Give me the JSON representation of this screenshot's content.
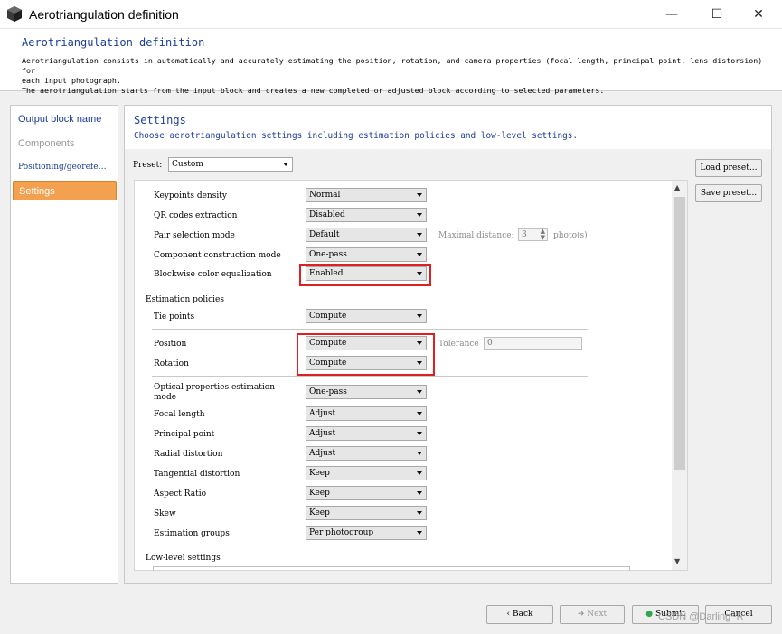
{
  "window": {
    "title": "Aerotriangulation definition",
    "minimize": "—",
    "maximize": "☐",
    "close": "✕"
  },
  "header": {
    "title": "Aerotriangulation definition",
    "desc_line1": "Aerotriangulation consists in automatically and accurately estimating the position, rotation, and camera properties (focal length, principal point, lens distorsion) for",
    "desc_line2": "each input photograph.",
    "desc_line3": "The aerotriangulation starts from the input block and creates a new completed or adjusted block according to selected parameters."
  },
  "nav": {
    "items": [
      {
        "label": "Output block name"
      },
      {
        "label": "Components"
      },
      {
        "label": "Positioning/georefe…"
      },
      {
        "label": "Settings"
      }
    ]
  },
  "main": {
    "title": "Settings",
    "desc": "Choose aerotriangulation settings including estimation policies and low-level settings.",
    "preset_label": "Preset:",
    "preset_value": "Custom",
    "load_preset": "Load preset...",
    "save_preset": "Save preset..."
  },
  "settings": {
    "keypoints_density": {
      "label": "Keypoints density",
      "value": "Normal"
    },
    "qr_codes": {
      "label": "QR codes extraction",
      "value": "Disabled"
    },
    "pair_selection": {
      "label": "Pair selection mode",
      "value": "Default"
    },
    "max_distance_label": "Maximal distance:",
    "max_distance_value": "3",
    "max_distance_unit": "photo(s)",
    "component_mode": {
      "label": "Component construction mode",
      "value": "One-pass"
    },
    "blockwise": {
      "label": "Blockwise color equalization",
      "value": "Enabled"
    },
    "estimation_policies": "Estimation policies",
    "tie_points": {
      "label": "Tie points",
      "value": "Compute"
    },
    "position": {
      "label": "Position",
      "value": "Compute"
    },
    "tolerance_label": "Tolerance",
    "tolerance_value": "0",
    "rotation": {
      "label": "Rotation",
      "value": "Compute"
    },
    "optical_mode": {
      "label_line1": "Optical properties estimation",
      "label_line2": "mode",
      "value": "One-pass"
    },
    "focal_length": {
      "label": "Focal length",
      "value": "Adjust"
    },
    "principal_point": {
      "label": "Principal point",
      "value": "Adjust"
    },
    "radial_distortion": {
      "label": "Radial distortion",
      "value": "Adjust"
    },
    "tangential_distortion": {
      "label": "Tangential distortion",
      "value": "Keep"
    },
    "aspect_ratio": {
      "label": "Aspect Ratio",
      "value": "Keep"
    },
    "skew": {
      "label": "Skew",
      "value": "Keep"
    },
    "estimation_groups": {
      "label": "Estimation groups",
      "value": "Per photogroup"
    },
    "low_level": "Low-level settings"
  },
  "footer": {
    "back": "Back",
    "next": "Next",
    "submit": "Submit",
    "cancel": "Cancel",
    "watermark": "CSDN @Darling~R"
  },
  "colors": {
    "accent_blue": "#1c3d9a",
    "nav_active": "#f3a04f",
    "highlight_red": "#e02020",
    "submit_green": "#2ea84a"
  }
}
